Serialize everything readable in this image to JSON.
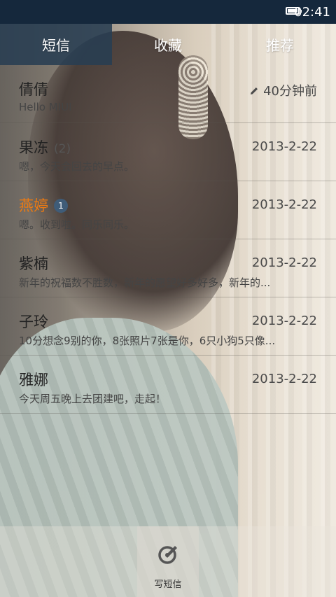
{
  "status_bar": {
    "time": "02:41",
    "battery_icon": "battery-icon"
  },
  "tabs": [
    {
      "label": "短信",
      "active": true
    },
    {
      "label": "收藏",
      "active": false
    },
    {
      "label": "推荐",
      "active": false
    }
  ],
  "messages": [
    {
      "name": "倩倩",
      "count": "",
      "badge": "",
      "time": "40分钟前",
      "preview": "Hello MIUI",
      "unread": false,
      "draft_icon": "pencil-icon"
    },
    {
      "name": "果冻",
      "count": "(2)",
      "badge": "",
      "time": "2013-2-22",
      "preview": "嗯，今天会回去的早点。",
      "unread": false
    },
    {
      "name": "燕婷",
      "count": "",
      "badge": "1",
      "time": "2013-2-22",
      "preview": "嗯。收到啦。同乐同乐。",
      "unread": true
    },
    {
      "name": "紫楠",
      "count": "",
      "badge": "",
      "time": "2013-2-22",
      "preview": "新年的祝福数不胜数，新年的愿望好多好多，新年的...",
      "unread": false
    },
    {
      "name": "子玲",
      "count": "",
      "badge": "",
      "time": "2013-2-22",
      "preview": "10分想念9别的你，8张照片7张是你，6只小狗5只像...",
      "unread": false
    },
    {
      "name": "雅娜",
      "count": "",
      "badge": "",
      "time": "2013-2-22",
      "preview": "今天周五晚上去团建吧，走起！",
      "unread": false
    }
  ],
  "bottom_bar": {
    "compose_label": "写短信",
    "compose_icon": "compose-icon"
  },
  "colors": {
    "unread_name": "#ec7a12",
    "active_tab_bg": "#283e52",
    "status_bar_bg": "#15283c"
  }
}
